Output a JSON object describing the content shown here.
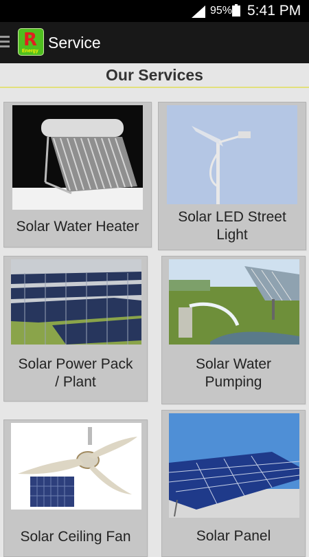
{
  "status_bar": {
    "battery": "95%",
    "time": "5:41 PM"
  },
  "app_bar": {
    "title": "Service",
    "logo_letter": "R",
    "logo_text": "Energy"
  },
  "page": {
    "heading": "Our Services"
  },
  "services": [
    {
      "line1": "Solar Water Heater",
      "line2": ""
    },
    {
      "line1": "Solar LED Street",
      "line2": "Light"
    },
    {
      "line1": "Solar Power Pack",
      "line2": "/ Plant"
    },
    {
      "line1": "Solar Water",
      "line2": "Pumping"
    },
    {
      "line1": "Solar Ceiling Fan",
      "line2": ""
    },
    {
      "line1": "Solar Panel",
      "line2": ""
    }
  ],
  "colors": {
    "background": "#e6e6e6",
    "card": "#c6c6c6",
    "appbar": "#181818",
    "logo": "#4fbf1f",
    "divider": "#e2e07b"
  }
}
